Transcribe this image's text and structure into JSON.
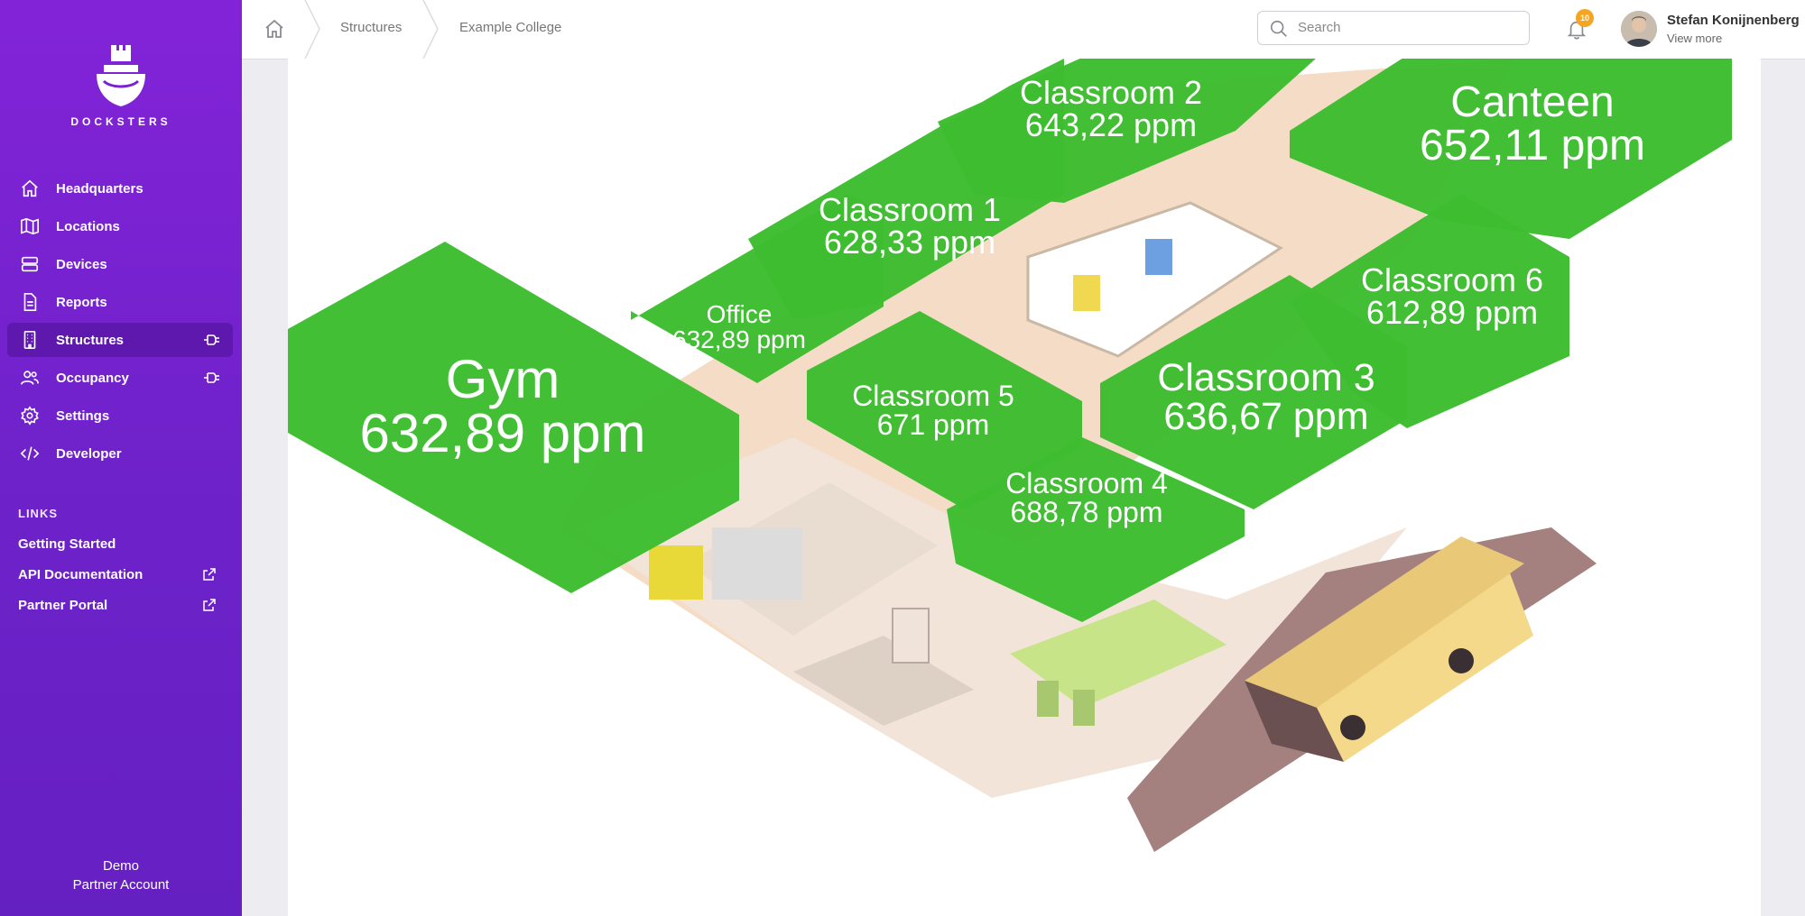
{
  "brand": {
    "name": "DOCKSTERS"
  },
  "nav": {
    "items": [
      {
        "label": "Headquarters",
        "icon": "home-icon"
      },
      {
        "label": "Locations",
        "icon": "map-icon"
      },
      {
        "label": "Devices",
        "icon": "devices-icon"
      },
      {
        "label": "Reports",
        "icon": "report-icon"
      },
      {
        "label": "Structures",
        "icon": "building-icon",
        "active": true
      },
      {
        "label": "Occupancy",
        "icon": "users-icon"
      },
      {
        "label": "Settings",
        "icon": "gear-icon"
      },
      {
        "label": "Developer",
        "icon": "code-icon"
      }
    ]
  },
  "links": {
    "title": "LINKS",
    "items": [
      {
        "label": "Getting Started"
      },
      {
        "label": "API Documentation"
      },
      {
        "label": "Partner Portal"
      }
    ]
  },
  "account": {
    "line1": "Demo",
    "line2": "Partner Account"
  },
  "breadcrumb": {
    "items": [
      "Structures",
      "Example College"
    ]
  },
  "search": {
    "placeholder": "Search"
  },
  "notifications": {
    "count": "10"
  },
  "user": {
    "name": "Stefan Konijnenberg",
    "sub": "View more"
  },
  "zones": [
    {
      "name": "Classroom 2",
      "value": "643,22 ppm"
    },
    {
      "name": "Canteen",
      "value": "652,11 ppm"
    },
    {
      "name": "Classroom 1",
      "value": "628,33 ppm"
    },
    {
      "name": "Office",
      "value": "632,89 ppm"
    },
    {
      "name": "Classroom 6",
      "value": "612,89 ppm"
    },
    {
      "name": "Gym",
      "value": "632,89 ppm"
    },
    {
      "name": "Classroom 5",
      "value": "671 ppm"
    },
    {
      "name": "Classroom 3",
      "value": "636,67 ppm"
    },
    {
      "name": "Classroom 4",
      "value": "688,78 ppm"
    }
  ],
  "colors": {
    "zone": "#3dbd30",
    "sidebar": "#7a22d2",
    "accent": "#f5a524"
  }
}
